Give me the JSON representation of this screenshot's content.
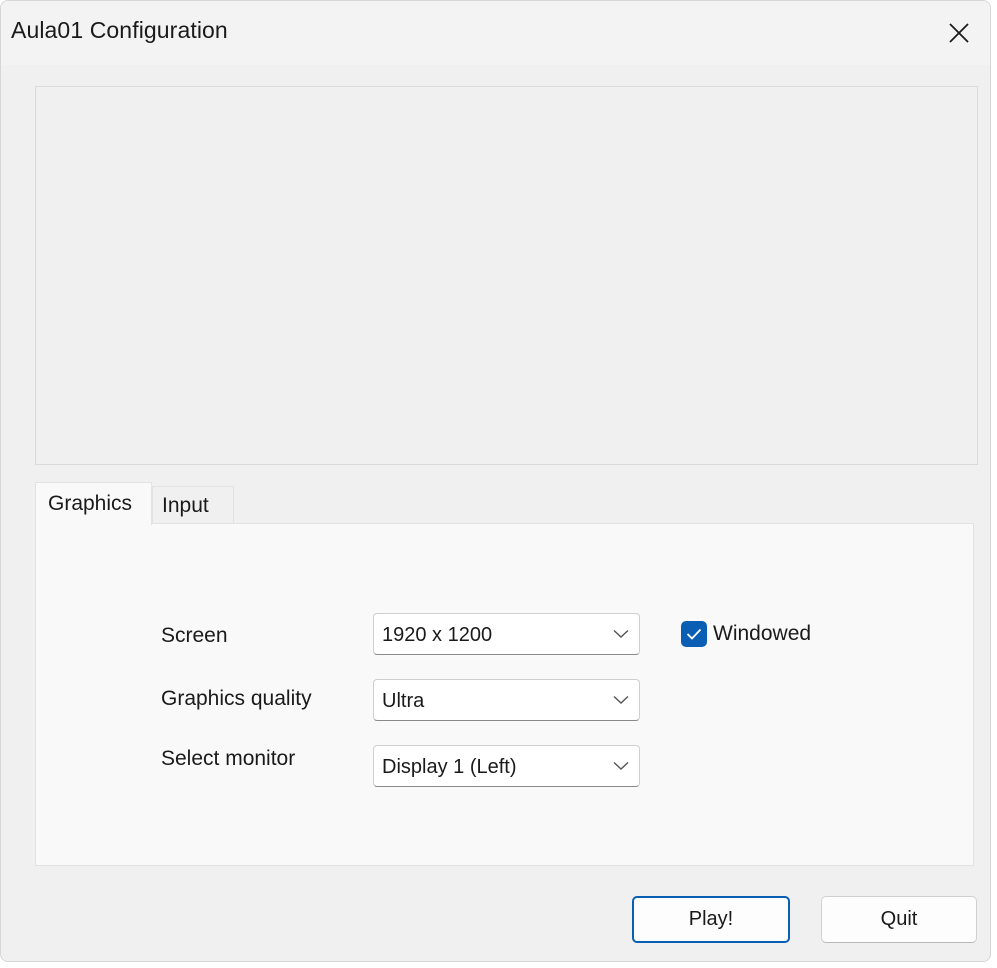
{
  "window": {
    "title": "Aula01 Configuration"
  },
  "tabs": [
    {
      "label": "Graphics",
      "active": true
    },
    {
      "label": "Input",
      "active": false
    }
  ],
  "graphics": {
    "screen": {
      "label": "Screen",
      "value": "1920 x 1200"
    },
    "quality": {
      "label": "Graphics quality",
      "value": "Ultra"
    },
    "monitor": {
      "label": "Select monitor",
      "value": "Display 1 (Left)"
    },
    "windowed": {
      "label": "Windowed",
      "checked": true
    }
  },
  "buttons": {
    "play": "Play!",
    "quit": "Quit"
  },
  "colors": {
    "accent": "#0a5fb4",
    "window_bg": "#f0f0f0",
    "panel_bg": "#f9f9f9"
  }
}
